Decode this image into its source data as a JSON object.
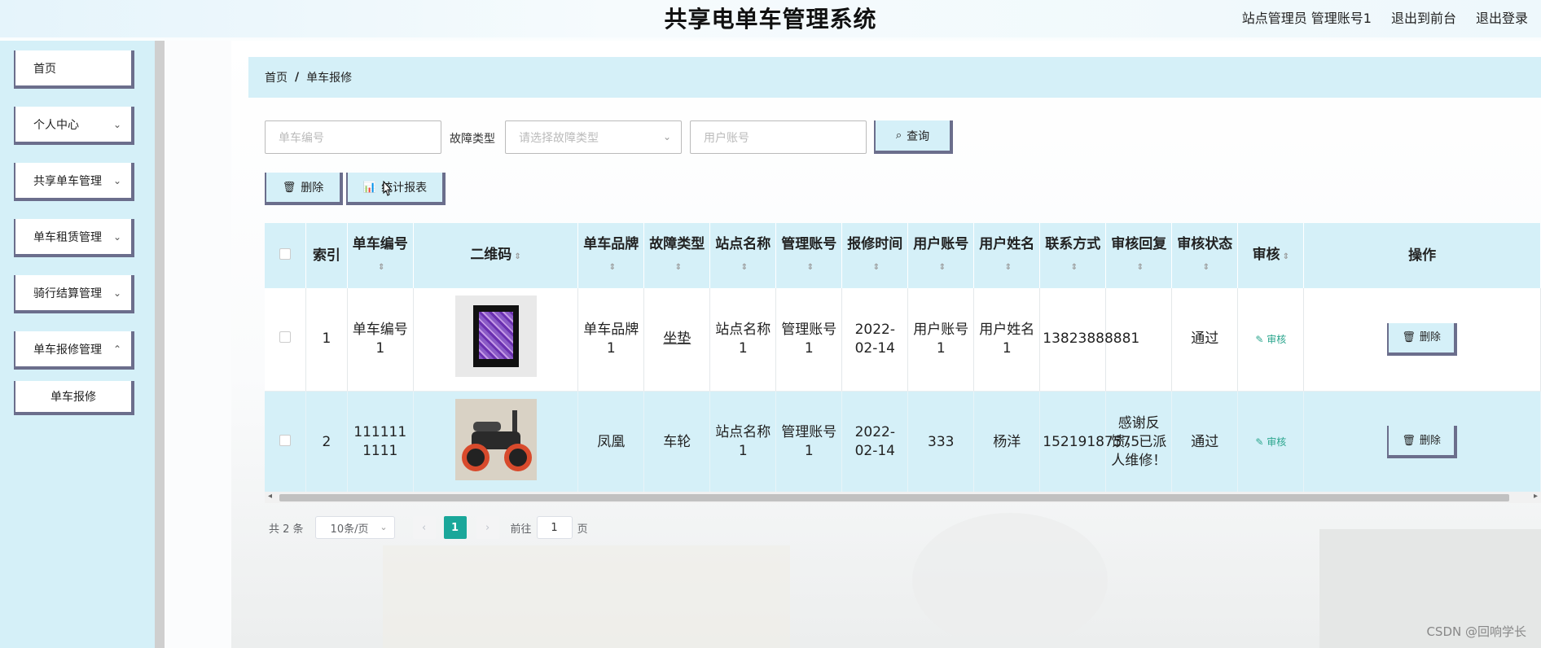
{
  "header": {
    "title": "共享电单车管理系统",
    "user_info": "站点管理员 管理账号1",
    "back_front": "退出到前台",
    "logout": "退出登录"
  },
  "sidebar": {
    "items": [
      {
        "label": "首页"
      },
      {
        "label": "个人中心"
      },
      {
        "label": "共享单车管理"
      },
      {
        "label": "单车租赁管理"
      },
      {
        "label": "骑行结算管理"
      },
      {
        "label": "单车报修管理"
      },
      {
        "label": "单车报修"
      }
    ]
  },
  "breadcrumb": {
    "home": "首页",
    "separator": "/",
    "current": "单车报修"
  },
  "filters": {
    "bike_no_placeholder": "单车编号",
    "fault_type_label": "故障类型",
    "fault_type_placeholder": "请选择故障类型",
    "user_account_placeholder": "用户账号",
    "query_label": "查询"
  },
  "actions": {
    "delete_label": "删除",
    "report_label": "统计报表"
  },
  "table": {
    "headers": {
      "index": "索引",
      "bike_no": "单车编号",
      "qrcode": "二维码",
      "brand": "单车品牌",
      "fault_type": "故障类型",
      "station_name": "站点名称",
      "manager_account": "管理账号",
      "report_time": "报修时间",
      "user_account": "用户账号",
      "user_name": "用户姓名",
      "contact": "联系方式",
      "audit_reply": "审核回复",
      "audit_status": "审核状态",
      "audit": "审核",
      "operation": "操作"
    },
    "rows": [
      {
        "index": "1",
        "bike_no": "单车编号1",
        "brand": "单车品牌1",
        "fault_type": "坐垫",
        "station_name": "站点名称1",
        "manager_account": "管理账号1",
        "report_time": "2022-02-14",
        "user_account": "用户账号1",
        "user_name": "用户姓名1",
        "contact": "13823888881",
        "audit_reply": "",
        "audit_status": "通过",
        "audit_action": "审核",
        "delete_label": "删除"
      },
      {
        "index": "2",
        "bike_no": "1111111111",
        "brand": "凤凰",
        "fault_type": "车轮",
        "station_name": "站点名称1",
        "manager_account": "管理账号1",
        "report_time": "2022-02-14",
        "user_account": "333",
        "user_name": "杨洋",
        "contact": "15219187575",
        "audit_reply": "感谢反馈，已派人维修！",
        "audit_status": "通过",
        "audit_action": "审核",
        "delete_label": "删除"
      }
    ]
  },
  "pagination": {
    "total": "共 2 条",
    "page_size": "10条/页",
    "current_page": "1",
    "goto_prefix": "前往",
    "goto_value": "1",
    "goto_suffix": "页"
  },
  "watermark": "CSDN @回响学长",
  "colors": {
    "accent_bg": "#d5f0f8",
    "button_border": "#6b6e8c",
    "active_page": "#1aa79a",
    "audit_link": "#2aa58d"
  }
}
